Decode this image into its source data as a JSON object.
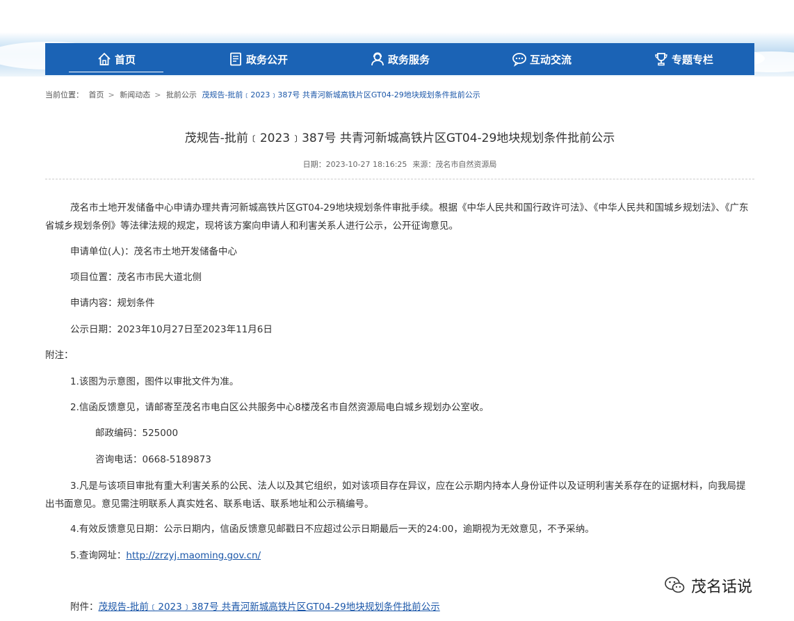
{
  "nav": {
    "items": [
      {
        "label": "首页",
        "icon": "home-icon",
        "active": true
      },
      {
        "label": "政务公开",
        "icon": "document-icon",
        "active": false
      },
      {
        "label": "政务服务",
        "icon": "service-person-icon",
        "active": false
      },
      {
        "label": "互动交流",
        "icon": "chat-bubble-icon",
        "active": false
      },
      {
        "label": "专题专栏",
        "icon": "trophy-icon",
        "active": false
      }
    ]
  },
  "breadcrumb": {
    "prefix": "当前位置：",
    "items": [
      "首页",
      "新闻动态",
      "批前公示"
    ],
    "separator": ">",
    "current": "茂规告-批前﹝2023﹞387号 共青河新城高铁片区GT04-29地块规划条件批前公示"
  },
  "article": {
    "title": "茂规告-批前﹝2023﹞387号 共青河新城高铁片区GT04-29地块规划条件批前公示",
    "date": "日期：2023-10-27 18:16:25",
    "source": "来源：茂名市自然资源局",
    "intro": "茂名市土地开发储备中心申请办理共青河新城高铁片区GT04-29地块规划条件审批手续。根据《中华人民共和国行政许可法》、《中华人民共和国城乡规划法》、《广东省城乡规划条例》等法律法规的规定，现将该方案向申请人和利害关系人进行公示，公开征询意见。",
    "applicant": "申请单位(人)：茂名市土地开发储备中心",
    "location": "项目位置：茂名市市民大道北侧",
    "content": "申请内容：规划条件",
    "period": "公示日期：2023年10月27日至2023年11月6日",
    "notes_label": "附注：",
    "note1": "1.该图为示意图，图件以审批文件为准。",
    "note2": "2.信函反馈意见，请邮寄至茂名市电白区公共服务中心8楼茂名市自然资源局电白城乡规划办公室收。",
    "postcode": "邮政编码：525000",
    "phone": "咨询电话：0668-5189873",
    "note3": "3.凡是与该项目审批有重大利害关系的公民、法人以及其它组织，如对该项目存在异议，应在公示期内持本人身份证件以及证明利害关系存在的证据材料，向我局提出书面意见。意见需注明联系人真实姓名、联系电话、联系地址和公示稿编号。",
    "note4": "4.有效反馈意见日期：公示日期内，信函反馈意见邮戳日不应超过公示日期最后一天的24:00，逾期视为无效意见，不予采纳。",
    "note5_label": "5.查询网址：",
    "note5_url": "http://zrzyj.maoming.gov.cn/",
    "attachment_label": "附件：",
    "attachment_link": "茂规告-批前﹝2023﹞387号 共青河新城高铁片区GT04-29地块规划条件批前公示"
  },
  "watermark": {
    "text": "茂名话说",
    "icon": "wechat-icon"
  },
  "colors": {
    "nav_bg": "#1b63b5",
    "link": "#1a56a8"
  }
}
